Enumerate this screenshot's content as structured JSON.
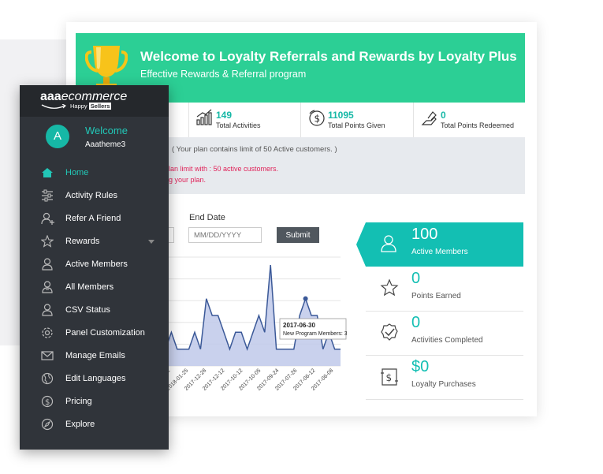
{
  "banner": {
    "title": "Welcome to Loyalty Referrals and Rewards by Loyalty Plus",
    "subtitle": "Effective Rewards & Referral program"
  },
  "stats": [
    {
      "value": "149",
      "label": "Total Activities",
      "icon": "chart-growth-icon"
    },
    {
      "value": "11095",
      "label": "Total Points Given",
      "icon": "dollar-coin-icon"
    },
    {
      "value": "0",
      "label": "Total Points Redeemed",
      "icon": "hand-redeem-icon"
    }
  ],
  "notice": {
    "line1": "( Your plan contains limit of 50 Active customers. )",
    "line2": "lan limit with : 50 active customers.",
    "line3": "g your plan."
  },
  "filters": {
    "end_date_label": "End Date",
    "end_date_placeholder": "MM/DD/YYYY",
    "submit_label": "Submit"
  },
  "chart_data": {
    "type": "area",
    "series_color": "#3b5998",
    "fill_color": "#bfc9ea",
    "x_ticks": [
      "2018-03-12",
      "2018-01-25",
      "2017-12-28",
      "2017-12-12",
      "2017-10-12",
      "2017-10-05",
      "2017-09-24",
      "2017-07-26",
      "2017-06-12",
      "2017-06-08"
    ],
    "y_values": [
      1,
      2,
      1,
      1,
      1,
      2,
      1,
      4,
      3,
      3,
      2,
      1,
      2,
      2,
      1,
      2,
      3,
      2,
      6,
      1,
      1,
      1,
      1,
      3,
      4,
      3,
      3,
      1,
      2,
      1,
      1
    ],
    "tooltip": {
      "date": "2017-06-30",
      "text": "New Program Members: 3"
    }
  },
  "kpis": [
    {
      "value": "100",
      "label": "Active Members",
      "icon": "user-icon",
      "highlight": true
    },
    {
      "value": "0",
      "label": "Points Earned",
      "icon": "star-icon"
    },
    {
      "value": "0",
      "label": "Activities Completed",
      "icon": "check-badge-icon"
    },
    {
      "value": "$0",
      "label": "Loyalty Purchases",
      "icon": "dollar-receipt-icon"
    }
  ],
  "sidebar": {
    "logo_main": "aaa",
    "logo_rest": "ecommerce",
    "tagline_pre": "Happy",
    "tagline_box": "Sellers",
    "welcome": "Welcome",
    "username": "Aaatheme3",
    "avatar_letter": "A",
    "items": [
      {
        "label": "Home",
        "icon": "home-icon",
        "active": true
      },
      {
        "label": "Activity Rules",
        "icon": "sliders-icon"
      },
      {
        "label": "Refer A Friend",
        "icon": "user-plus-icon"
      },
      {
        "label": "Rewards",
        "icon": "star-icon",
        "has_dropdown": true
      },
      {
        "label": "Active Members",
        "icon": "member-icon"
      },
      {
        "label": "All Members",
        "icon": "members-icon"
      },
      {
        "label": "CSV Status",
        "icon": "csv-user-icon"
      },
      {
        "label": "Panel Customization",
        "icon": "gear-icon"
      },
      {
        "label": "Manage Emails",
        "icon": "envelope-icon"
      },
      {
        "label": "Edit Languages",
        "icon": "globe-icon"
      },
      {
        "label": "Pricing",
        "icon": "dollar-circle-icon"
      },
      {
        "label": "Explore",
        "icon": "compass-icon"
      }
    ]
  }
}
